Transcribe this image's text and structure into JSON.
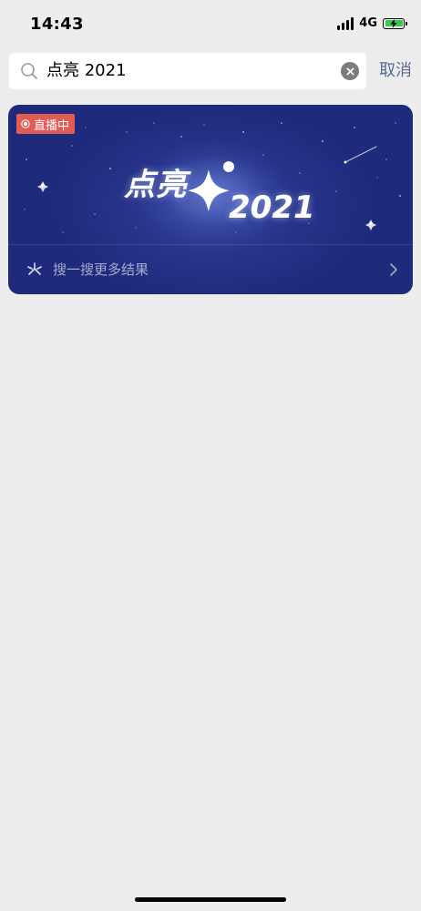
{
  "status_bar": {
    "time": "14:43",
    "network": "4G"
  },
  "search": {
    "query": "点亮 2021",
    "cancel_label": "取消"
  },
  "live_card": {
    "badge": "直播中",
    "more_label": "搜一搜更多结果",
    "colors": {
      "card_bg": "#1e2a7b",
      "badge_bg": "#e35b55"
    }
  },
  "icons": {
    "search": "search-icon",
    "clear": "clear-icon",
    "search_more": "sou-yi-sou-icon",
    "chevron": "chevron-right-icon"
  },
  "colors": {
    "page_bg": "#ededed",
    "cancel_text": "#576b95",
    "battery_fill": "#38c94a"
  }
}
